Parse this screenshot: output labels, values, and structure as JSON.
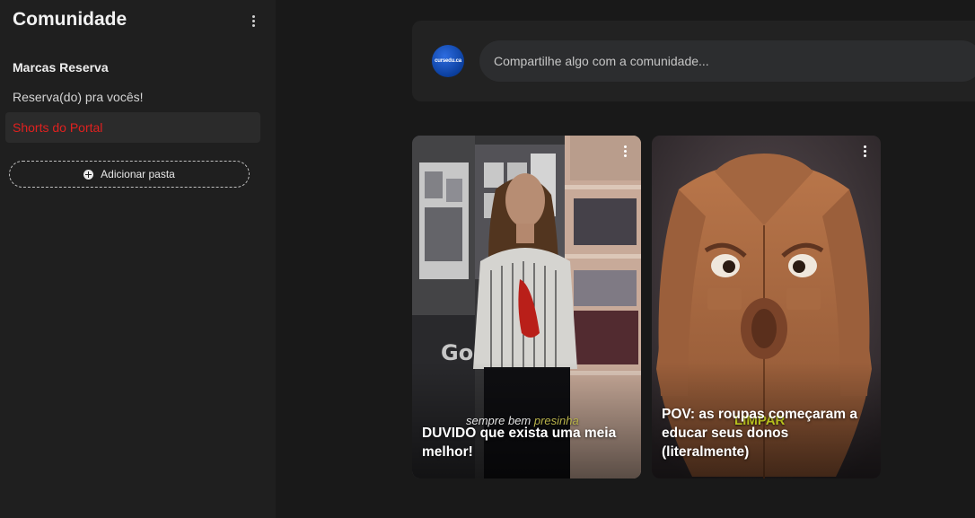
{
  "sidebar": {
    "title": "Comunidade",
    "section_title": "Marcas Reserva",
    "items": [
      {
        "label": "Reserva(do) pra vocês!"
      },
      {
        "label": "Shorts do Portal"
      }
    ],
    "add_folder_label": "Adicionar pasta"
  },
  "composer": {
    "avatar_text": "cursedu.ca",
    "placeholder": "Compartilhe algo com a comunidade..."
  },
  "cards": [
    {
      "caption": "DUVIDO que exista uma meia melhor!",
      "overlay_prefix": "sempre bem",
      "overlay_highlight": "presinha"
    },
    {
      "caption": "POV: as roupas começaram a educar seus donos (literalmente)",
      "overlay_word": "LIMPAR"
    }
  ],
  "colors": {
    "active_item_text": "#e0211f",
    "background": "#191919",
    "sidebar": "#1f1f1f"
  }
}
